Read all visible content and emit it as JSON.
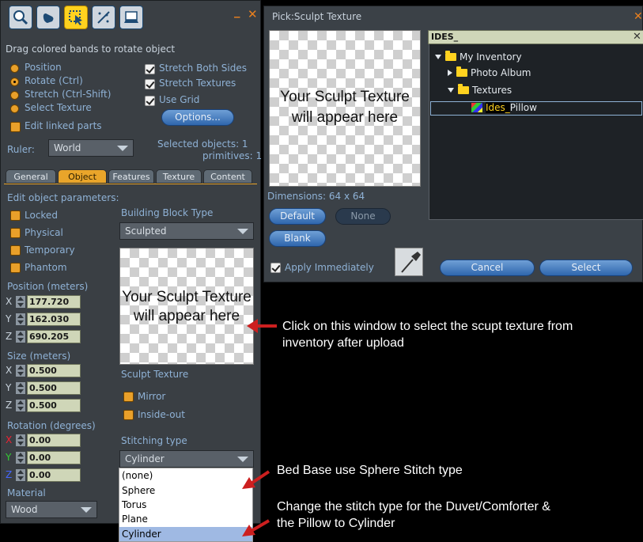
{
  "build_panel": {
    "hint": "Drag colored bands to rotate object",
    "modes": [
      "Position",
      "Rotate (Ctrl)",
      "Stretch (Ctrl-Shift)",
      "Select Texture"
    ],
    "edit_linked": "Edit linked parts",
    "stretch_both": "Stretch Both Sides",
    "stretch_textures": "Stretch Textures",
    "use_grid": "Use Grid",
    "options_button": "Options...",
    "ruler_label": "Ruler:",
    "ruler_value": "World",
    "selected_objects": "Selected objects: 1",
    "primitives": "primitives: 1",
    "tabs": [
      "General",
      "Object",
      "Features",
      "Texture",
      "Content"
    ],
    "edit_params": "Edit object parameters:",
    "locked": "Locked",
    "physical": "Physical",
    "temporary": "Temporary",
    "phantom": "Phantom",
    "building_block_label": "Building Block Type",
    "building_block_value": "Sculpted",
    "position_label": "Position (meters)",
    "pos_x": "177.720",
    "pos_y": "162.030",
    "pos_z": "690.205",
    "size_label": "Size (meters)",
    "size_x": "0.500",
    "size_y": "0.500",
    "size_z": "0.500",
    "rotation_label": "Rotation (degrees)",
    "rot_x": "0.00",
    "rot_y": "0.00",
    "rot_z": "0.00",
    "material_label": "Material",
    "material_value": "Wood",
    "sculpt_preview_line1": "Your Sculpt Texture",
    "sculpt_preview_line2": "will appear here",
    "sculpt_texture_label": "Sculpt Texture",
    "mirror": "Mirror",
    "inside_out": "Inside-out",
    "stitching_label": "Stitching type",
    "stitching_value": "Cylinder",
    "stitching_options": [
      "(none)",
      "Sphere",
      "Torus",
      "Plane",
      "Cylinder"
    ]
  },
  "picker": {
    "title": "Pick:Sculpt Texture",
    "preview_line1": "Your Sculpt Texture",
    "preview_line2": "will appear here",
    "dimensions": "Dimensions: 64 x 64",
    "default_button": "Default",
    "none_button": "None",
    "blank_button": "Blank",
    "apply_immediately": "Apply Immediately",
    "search_value": "IDES_",
    "tree": {
      "root": "My Inventory",
      "photo_album": "Photo Album",
      "textures": "Textures",
      "item_match": "Ides_",
      "item_rest": "Pillow"
    },
    "cancel_button": "Cancel",
    "select_button": "Select"
  },
  "annotations": {
    "note1_line1": "Click on this window to select the scupt texture from",
    "note1_line2": "inventory after upload",
    "note2": "Bed Base use Sphere Stitch type",
    "note3_line1": "Change the stitch type for the Duvet/Comforter &",
    "note3_line2": "the Pillow to Cylinder"
  },
  "colors": {
    "accent": "#e9a52a",
    "button_blue": "#4a82c4",
    "arrow_red": "#cc1f1f"
  },
  "icons": [
    "zoom-tool-icon",
    "grab-tool-icon",
    "select-tool-icon",
    "create-tool-icon",
    "land-tool-icon",
    "eyedropper-icon"
  ]
}
